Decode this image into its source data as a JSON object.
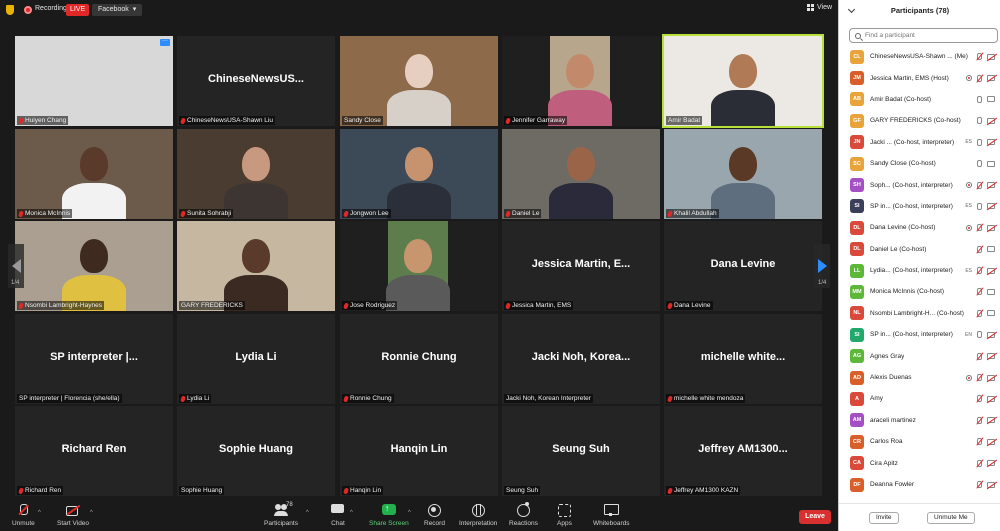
{
  "topbar": {
    "recording_label": "Recording",
    "live_label": "LIVE",
    "stream_target": "Facebook",
    "view_label": "View"
  },
  "grid": {
    "page_left": "1/4",
    "page_right": "1/4",
    "tiles": [
      {
        "name": "Huiyen Chang",
        "big": "",
        "muted": true
      },
      {
        "name": "ChineseNewsUSA-Shawn Liu",
        "big": "ChineseNewsUS...",
        "muted": true
      },
      {
        "name": "Sandy Close",
        "big": "",
        "muted": false
      },
      {
        "name": "Jennifer Garraway",
        "big": "",
        "muted": true
      },
      {
        "name": "Amir Badat",
        "big": "",
        "muted": false
      },
      {
        "name": "Monica McInnis",
        "big": "",
        "muted": true
      },
      {
        "name": "Sunita Sohrabji",
        "big": "",
        "muted": true
      },
      {
        "name": "Jongwon Lee",
        "big": "",
        "muted": true
      },
      {
        "name": "Daniel Le",
        "big": "",
        "muted": true
      },
      {
        "name": "Khalil Abdullah",
        "big": "",
        "muted": true
      },
      {
        "name": "Nsombi Lambright-Haynes",
        "big": "",
        "muted": true
      },
      {
        "name": "GARY FREDERICKS",
        "big": "",
        "muted": false
      },
      {
        "name": "Jose Rodriguez",
        "big": "",
        "muted": true
      },
      {
        "name": "Jessica Martin, EMS",
        "big": "Jessica Martin, E...",
        "muted": true
      },
      {
        "name": "Dana Levine",
        "big": "Dana Levine",
        "muted": true
      },
      {
        "name": "SP interpreter | Florencia (she/ella)",
        "big": "SP interpreter |...",
        "muted": false
      },
      {
        "name": "Lydia Li",
        "big": "Lydia Li",
        "muted": true
      },
      {
        "name": "Ronnie Chung",
        "big": "Ronnie Chung",
        "muted": true
      },
      {
        "name": "Jacki Noh, Korean Interpreter",
        "big": "Jacki Noh, Korea...",
        "muted": false
      },
      {
        "name": "michelle white mendoza",
        "big": "michelle  white...",
        "muted": true
      },
      {
        "name": "Richard Ren",
        "big": "Richard Ren",
        "muted": true
      },
      {
        "name": "Sophie Huang",
        "big": "Sophie Huang",
        "muted": false
      },
      {
        "name": "Hanqin Lin",
        "big": "Hanqin Lin",
        "muted": true
      },
      {
        "name": "Seung Suh",
        "big": "Seung Suh",
        "muted": false
      },
      {
        "name": "Jeffrey AM1300 KAZN",
        "big": "Jeffrey  AM1300...",
        "muted": true
      }
    ]
  },
  "toolbar": {
    "unmute": "Unmute",
    "start_video": "Start Video",
    "participants": "Participants",
    "participants_count": "78",
    "chat": "Chat",
    "share_screen": "Share Screen",
    "record": "Record",
    "interpretation": "Interpretation",
    "reactions": "Reactions",
    "apps": "Apps",
    "whiteboards": "Whiteboards",
    "leave": "Leave"
  },
  "panel": {
    "title": "Participants (78)",
    "search_placeholder": "Find a participant",
    "invite": "Invite",
    "mute_me": "Unmute Me",
    "participants": [
      {
        "initials": "CL",
        "color": "#e8a33a",
        "name": "ChineseNewsUSA-Shawn ...  (Me)",
        "icons": [
          "mic-muted",
          "cam-muted"
        ]
      },
      {
        "initials": "JM",
        "color": "#d95f2a",
        "name": "Jessica Martin, EMS (Host)",
        "icons": [
          "rec",
          "mic-muted",
          "cam-muted"
        ]
      },
      {
        "initials": "AB",
        "color": "#e8a33a",
        "name": "Amir Badat (Co-host)",
        "icons": [
          "mic",
          "cam"
        ]
      },
      {
        "initials": "GF",
        "color": "#e8a33a",
        "name": "GARY FREDERICKS (Co-host)",
        "icons": [
          "mic",
          "cam-muted"
        ]
      },
      {
        "initials": "JN",
        "color": "#d94a3a",
        "name": "Jacki ... (Co-host, interpreter)",
        "icons": [
          "lang-ES",
          "mic",
          "cam-muted"
        ]
      },
      {
        "initials": "SC",
        "color": "#e8a33a",
        "name": "Sandy Close (Co-host)",
        "icons": [
          "mic",
          "cam"
        ]
      },
      {
        "initials": "SH",
        "color": "#a44fc4",
        "name": "Soph... (Co-host, interpreter)",
        "icons": [
          "rec",
          "mic-muted",
          "cam-muted"
        ]
      },
      {
        "initials": "SI",
        "color": "#3a3f5a",
        "name": "SP in... (Co-host, interpreter)",
        "icons": [
          "lang-ES",
          "mic",
          "cam-muted"
        ]
      },
      {
        "initials": "DL",
        "color": "#d94a3a",
        "name": "Dana Levine (Co-host)",
        "icons": [
          "rec",
          "mic-muted",
          "cam-muted"
        ]
      },
      {
        "initials": "DL",
        "color": "#d94a3a",
        "name": "Daniel Le (Co-host)",
        "icons": [
          "mic-muted",
          "cam"
        ]
      },
      {
        "initials": "LL",
        "color": "#5db83a",
        "name": "Lydia... (Co-host, interpreter)",
        "icons": [
          "lang-ES",
          "mic-muted",
          "cam-muted"
        ]
      },
      {
        "initials": "MM",
        "color": "#5db83a",
        "name": "Monica McInnis (Co-host)",
        "icons": [
          "mic-muted",
          "cam"
        ]
      },
      {
        "initials": "NL",
        "color": "#d94a3a",
        "name": "Nsombi Lambright-H... (Co-host)",
        "icons": [
          "mic-muted",
          "cam"
        ]
      },
      {
        "initials": "SI",
        "color": "#23a86b",
        "name": "SP in... (Co-host, interpreter)",
        "icons": [
          "lang-EN",
          "mic",
          "cam-muted"
        ]
      },
      {
        "initials": "AG",
        "color": "#5db83a",
        "name": "Agnes Gray",
        "icons": [
          "mic-muted",
          "cam-muted"
        ]
      },
      {
        "initials": "AD",
        "color": "#d95f2a",
        "name": "Alexis Duenas",
        "icons": [
          "rec",
          "mic-muted",
          "cam-muted"
        ]
      },
      {
        "initials": "A",
        "color": "#d94a3a",
        "name": "Amy",
        "icons": [
          "mic-muted",
          "cam-muted"
        ]
      },
      {
        "initials": "AM",
        "color": "#a44fc4",
        "name": "araceli martinez",
        "icons": [
          "mic-muted",
          "cam-muted"
        ]
      },
      {
        "initials": "CR",
        "color": "#d95f2a",
        "name": "Carlos Roa",
        "icons": [
          "mic-muted",
          "cam-muted"
        ]
      },
      {
        "initials": "CA",
        "color": "#d94a3a",
        "name": "Cira Apitz",
        "icons": [
          "mic-muted",
          "cam-muted"
        ]
      },
      {
        "initials": "DF",
        "color": "#d95f2a",
        "name": "Deanna Fowler",
        "icons": [
          "mic-muted",
          "cam-muted"
        ]
      }
    ]
  }
}
